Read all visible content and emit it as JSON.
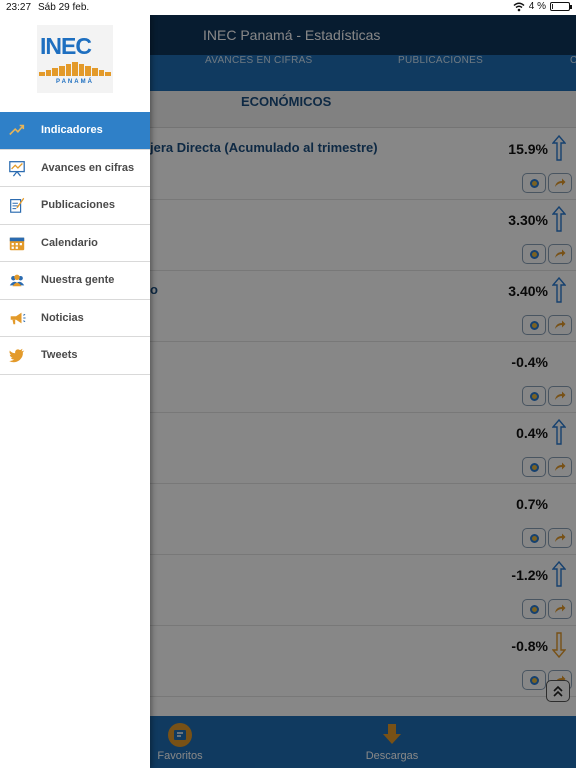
{
  "status_bar": {
    "time": "23:27",
    "date": "Sáb 29 feb.",
    "battery": "4 %",
    "battery_level": 0.04
  },
  "app": {
    "title": "INEC Panamá - Estadísticas",
    "tabs": [
      "AVANCES EN CIFRAS",
      "PUBLICACIONES",
      "C"
    ],
    "section": "ECONÓMICOS",
    "rows": [
      {
        "title": "jera Directa (Acumulado al trimestre)",
        "value": "15.9%",
        "trend": "up"
      },
      {
        "title": "",
        "value": "3.30%",
        "trend": "up"
      },
      {
        "title": "o",
        "value": "3.40%",
        "trend": "up"
      },
      {
        "title": "",
        "value": "-0.4%",
        "trend": "none"
      },
      {
        "title": "",
        "value": "0.4%",
        "trend": "up"
      },
      {
        "title": "",
        "value": "0.7%",
        "trend": "none"
      },
      {
        "title": "",
        "value": "-1.2%",
        "trend": "up"
      },
      {
        "title": "",
        "value": "-0.8%",
        "trend": "down"
      }
    ],
    "bottom": {
      "favoritos": "Favoritos",
      "descargas": "Descargas"
    },
    "colors": {
      "nav": "#0f355c",
      "tab_bar": "#1f6fb5",
      "up_arrow": "#2b7bd1",
      "down_arrow": "#e39a2a"
    }
  },
  "drawer": {
    "logo": {
      "text": "INEC",
      "sub": "PANAMÁ"
    },
    "items": [
      {
        "label": "Indicadores",
        "icon": "trending-up-icon",
        "active": true
      },
      {
        "label": "Avances en cifras",
        "icon": "presentation-chart-icon",
        "active": false
      },
      {
        "label": "Publicaciones",
        "icon": "document-edit-icon",
        "active": false
      },
      {
        "label": "Calendario",
        "icon": "calendar-icon",
        "active": false
      },
      {
        "label": "Nuestra gente",
        "icon": "people-icon",
        "active": false
      },
      {
        "label": "Noticias",
        "icon": "megaphone-icon",
        "active": false
      },
      {
        "label": "Tweets",
        "icon": "twitter-bird-icon",
        "active": false
      }
    ],
    "active_color": "#2f80c8"
  }
}
